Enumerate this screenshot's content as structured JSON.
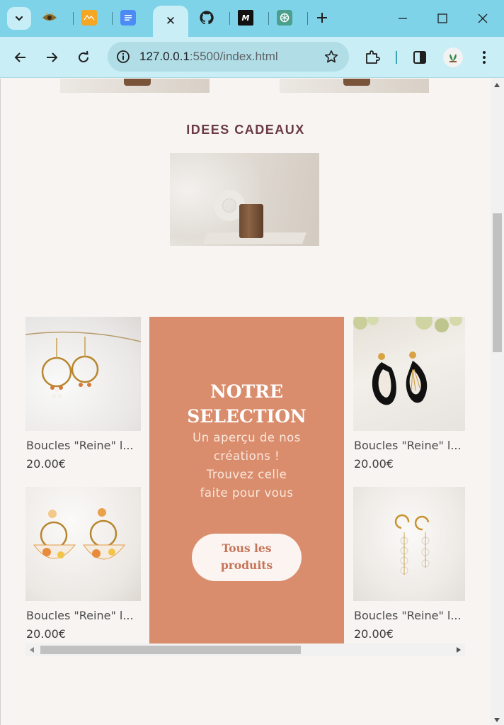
{
  "browser": {
    "tabs": [
      {
        "icon": "eye-logo-icon"
      },
      {
        "icon": "orange-app-icon"
      },
      {
        "icon": "google-docs-icon"
      },
      {
        "icon": "active-tab-close-icon",
        "close_glyph": "✕"
      },
      {
        "icon": "github-icon"
      },
      {
        "icon": "medium-logo-icon",
        "glyph": "M"
      },
      {
        "icon": "chatgpt-icon"
      }
    ],
    "new_tab_glyph": "+",
    "url_host": "127.0.0.1",
    "url_path": ":5500/index.html",
    "colors": {
      "tabstrip": "#7ed3e8",
      "toolbar": "#c9eef6",
      "omnibox": "#b0dde6"
    }
  },
  "page": {
    "section_title": "IDEES CADEAUX",
    "promo": {
      "title_line1": "NOTRE",
      "title_line2": "SELECTION",
      "subtitle_line1": "Un aperçu de nos",
      "subtitle_line2": "créations !",
      "subtitle_line3": "Trouvez celle",
      "subtitle_line4": "faite pour vous",
      "cta_line1": "Tous les",
      "cta_line2": "produits",
      "color": "#d98d6c"
    },
    "products": [
      {
        "name": "Boucles \"Reine\" l...",
        "price": "20.00€"
      },
      {
        "name": "Boucles \"Reine\" l...",
        "price": "20.00€"
      },
      {
        "name": "Boucles \"Reine\" l...",
        "price": "20.00€"
      },
      {
        "name": "Boucles \"Reine\" l...",
        "price": "20.00€"
      }
    ],
    "title_color": "#6b3a44"
  }
}
